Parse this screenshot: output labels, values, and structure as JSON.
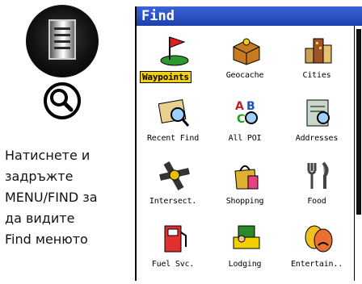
{
  "caption": {
    "line1": "Натиснете и",
    "line2": "задръжте",
    "line3": "MENU/FIND за",
    "line4": "да видите",
    "line5": "Find менюто"
  },
  "screen": {
    "title": "Find",
    "scroll_position": 0.0,
    "items": [
      {
        "label": "Waypoints",
        "icon": "waypoint-flag-icon",
        "selected": true
      },
      {
        "label": "Geocache",
        "icon": "treasure-chest-icon",
        "selected": false
      },
      {
        "label": "Cities",
        "icon": "buildings-icon",
        "selected": false
      },
      {
        "label": "Recent Find",
        "icon": "map-magnifier-icon",
        "selected": false
      },
      {
        "label": "All POI",
        "icon": "abc-magnifier-icon",
        "selected": false
      },
      {
        "label": "Addresses",
        "icon": "address-book-icon",
        "selected": false
      },
      {
        "label": "Intersect.",
        "icon": "intersection-icon",
        "selected": false
      },
      {
        "label": "Shopping",
        "icon": "shopping-bag-icon",
        "selected": false
      },
      {
        "label": "Food",
        "icon": "fork-knife-icon",
        "selected": false
      },
      {
        "label": "Fuel Svc.",
        "icon": "fuel-pump-icon",
        "selected": false
      },
      {
        "label": "Lodging",
        "icon": "bed-icon",
        "selected": false
      },
      {
        "label": "Entertain..",
        "icon": "theater-masks-icon",
        "selected": false
      }
    ]
  },
  "colors": {
    "titlebar": "#2a50c8",
    "selection": "#f4d000"
  }
}
